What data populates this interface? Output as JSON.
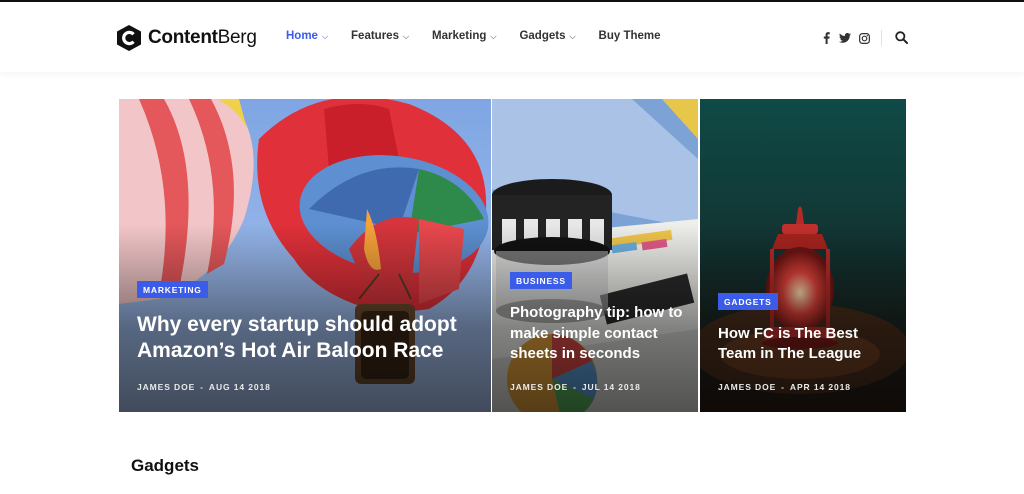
{
  "brand": {
    "name_bold": "Content",
    "name_light": "Berg"
  },
  "nav": {
    "items": [
      {
        "label": "Home",
        "active": true,
        "has_dropdown": true
      },
      {
        "label": "Features",
        "active": false,
        "has_dropdown": true
      },
      {
        "label": "Marketing",
        "active": false,
        "has_dropdown": true
      },
      {
        "label": "Gadgets",
        "active": false,
        "has_dropdown": true
      },
      {
        "label": "Buy Theme",
        "active": false,
        "has_dropdown": false
      }
    ],
    "dropdown_caret": "⌵"
  },
  "social": [
    "facebook-icon",
    "twitter-icon",
    "instagram-icon"
  ],
  "accent_color": "#3b5ce8",
  "featured": [
    {
      "category": "MARKETING",
      "title": "Why every startup should adopt Amazon’s Hot Air Baloon Race",
      "author": "JAMES DOE",
      "date": "AUG 14 2018"
    },
    {
      "category": "BUSINESS",
      "title": "Photography tip: how to make simple contact sheets in seconds",
      "author": "JAMES DOE",
      "date": "JUL 14 2018"
    },
    {
      "category": "GADGETS",
      "title": "How FC is The Best Team in The League",
      "author": "JAMES DOE",
      "date": "APR 14 2018"
    }
  ],
  "meta_separator": "-",
  "section": {
    "title": "Gadgets"
  }
}
